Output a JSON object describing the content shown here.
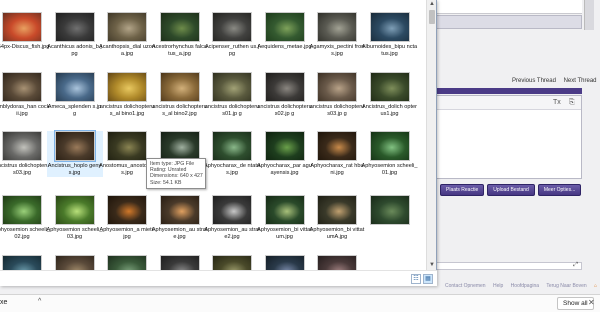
{
  "explorer": {
    "items": [
      {
        "name": "654px-Discus_fish.jpg",
        "colors": [
          "#c94a2a",
          "#e8a060",
          "#6a3020"
        ]
      },
      {
        "name": "Acanthicus adonis_b.jpg",
        "colors": [
          "#3a3a3a",
          "#707070",
          "#1e1e1e"
        ]
      },
      {
        "name": "Acanthopsis_dial uzona.jpg",
        "colors": [
          "#6e6248",
          "#b2a488",
          "#3e3626"
        ]
      },
      {
        "name": "Acestrorhynchus falcatus_a.jpg",
        "colors": [
          "#2e4a2a",
          "#6e8c4a",
          "#1c2c18"
        ]
      },
      {
        "name": "Acipenser_ruthen us.jpg",
        "colors": [
          "#41413f",
          "#8a8a84",
          "#22221f"
        ]
      },
      {
        "name": "Aequidens_metae.jpg",
        "colors": [
          "#345a30",
          "#7ea25a",
          "#1c3a1a"
        ]
      },
      {
        "name": "Agamyxis_pectini frons.jpg",
        "colors": [
          "#5a5a52",
          "#a2a294",
          "#2e2e28"
        ]
      },
      {
        "name": "Alburnoides_bipu nctatus.jpg",
        "colors": [
          "#2c4a62",
          "#7e9eb6",
          "#182a38"
        ]
      },
      {
        "name": "Amblydoras_han cockii.jpg",
        "colors": [
          "#5a4a38",
          "#a89274",
          "#2e241a"
        ]
      },
      {
        "name": "Ameca_splenden s.jpg",
        "colors": [
          "#4a6a8a",
          "#aac4dc",
          "#24384c"
        ]
      },
      {
        "name": "ancistrus dolichopterus_al bino1.jpg",
        "colors": [
          "#b08a2a",
          "#e8c860",
          "#604414"
        ]
      },
      {
        "name": "ancistrus dolichopterus_al bino2.jpg",
        "colors": [
          "#8a6a3a",
          "#d2b07a",
          "#4a3418"
        ]
      },
      {
        "name": "ancistrus dolichopterus01.jp g",
        "colors": [
          "#5a5a3e",
          "#a2a276",
          "#2e2e1e"
        ]
      },
      {
        "name": "ancistrus dolichopterus02.jp g",
        "colors": [
          "#3c3a38",
          "#8a8680",
          "#1e1c1a"
        ]
      },
      {
        "name": "ancistrus dolichopterus03.jp g",
        "colors": [
          "#6a5a4a",
          "#b8a288",
          "#3a2e22"
        ]
      },
      {
        "name": "Ancistrus_dolich opterus1.jpg",
        "colors": [
          "#3a4a2a",
          "#7e8e5a",
          "#1e2814"
        ]
      },
      {
        "name": "ancistrus dolichopterus03.jpg",
        "colors": [
          "#6a6a68",
          "#c2c2bc",
          "#343432"
        ]
      },
      {
        "name": "Ancistrus_hoplo genys.jpg",
        "colors": [
          "#4a3a2a",
          "#9a7a5a",
          "#261c12"
        ]
      },
      {
        "name": "Anostomus_anostomus.jpg",
        "colors": [
          "#3a3a22",
          "#8a8452",
          "#1e1e10"
        ]
      },
      {
        "name": "Aphyocharax_ani sitsi.jpg",
        "colors": [
          "#2a3a2a",
          "#a0b0a0",
          "#141e14"
        ]
      },
      {
        "name": "Aphyocharax_de ntatus.jpg",
        "colors": [
          "#2e4e2e",
          "#8ab88a",
          "#182a18"
        ]
      },
      {
        "name": "Aphyocharax_par aguayensis.jpg",
        "colors": [
          "#1e3e1e",
          "#6aa04a",
          "#0e200e"
        ]
      },
      {
        "name": "Aphyocharax_rat hbuni.jpg",
        "colors": [
          "#3a2a1a",
          "#c88a4a",
          "#1e140a"
        ]
      },
      {
        "name": "Aphyosemion scheeli_01.jpg",
        "colors": [
          "#2a5a2a",
          "#82c282",
          "#143014"
        ]
      },
      {
        "name": "Aphyosemion scheeli_02.jpg",
        "colors": [
          "#3a6a2a",
          "#9ad07a",
          "#1e3814"
        ]
      },
      {
        "name": "Aphyosemion scheeli_03.jpg",
        "colors": [
          "#4a7a2a",
          "#b8e07a",
          "#284414"
        ]
      },
      {
        "name": "Aphyosemion_a mieti.jpg",
        "colors": [
          "#3a2a1a",
          "#d0782a",
          "#1e140a"
        ]
      },
      {
        "name": "Aphyosemion_au strale.jpg",
        "colors": [
          "#4a3a2a",
          "#e0a060",
          "#261c12"
        ]
      },
      {
        "name": "Aphyosemion_au strale2.jpg",
        "colors": [
          "#3a3a3a",
          "#c8c8c8",
          "#1e1e1e"
        ]
      },
      {
        "name": "Aphyosemion_bi vittatum.jpg",
        "colors": [
          "#2a4a2a",
          "#a8c07a",
          "#142814"
        ]
      },
      {
        "name": "Aphyosemion_bi vittatumA.jpg",
        "colors": [
          "#3a3a2a",
          "#c0a070",
          "#1e1e14"
        ]
      },
      {
        "name": "",
        "colors": [
          "#2e4a2e",
          "#6a8a5a",
          "#182818"
        ]
      },
      {
        "name": "",
        "colors": [
          "#2a4a5a",
          "#6a9aaa",
          "#142830"
        ]
      },
      {
        "name": "",
        "colors": [
          "#5a4a3a",
          "#a08a6a",
          "#2e241a"
        ]
      },
      {
        "name": "",
        "colors": [
          "#3a5a3a",
          "#7aa07a",
          "#1e301e"
        ]
      },
      {
        "name": "",
        "colors": [
          "#3a3a3a",
          "#8a8a8a",
          "#1e1e1e"
        ]
      },
      {
        "name": "",
        "colors": [
          "#4a4a2a",
          "#9a9a6a",
          "#262614"
        ]
      },
      {
        "name": "",
        "colors": [
          "#2a3a4a",
          "#7a8aaa",
          "#141e26"
        ]
      },
      {
        "name": "",
        "colors": [
          "#4a3a3a",
          "#a08080",
          "#261e1e"
        ]
      }
    ],
    "tooltip": {
      "type": "Item type: JPG File",
      "rating": "Rating: Unrated",
      "dimensions": "Dimensions: 640 x 427",
      "size": "Size: 54.1 KB"
    },
    "scroll_up": "▲",
    "scroll_down": "▼",
    "view_details_icon": "☷",
    "view_large_icon": "▦"
  },
  "forum": {
    "previous_thread": "Previous Thread",
    "next_thread": "Next Thread",
    "editor_tool_1": "Tx",
    "editor_tool_2": "⎘",
    "buttons": [
      "Plaats Reactie",
      "Upload Bestand",
      "Meer Opties..."
    ],
    "field_icon": "⤢",
    "footer_links": [
      "Contact Opnemen",
      "Help",
      "Hoofdpagina",
      "Terug Naar Boven",
      "⌂"
    ],
    "accent": "#4b3b87"
  },
  "downloads": {
    "file_label": "xe",
    "caret": "^",
    "show_all": "Show all",
    "close": "✕"
  }
}
